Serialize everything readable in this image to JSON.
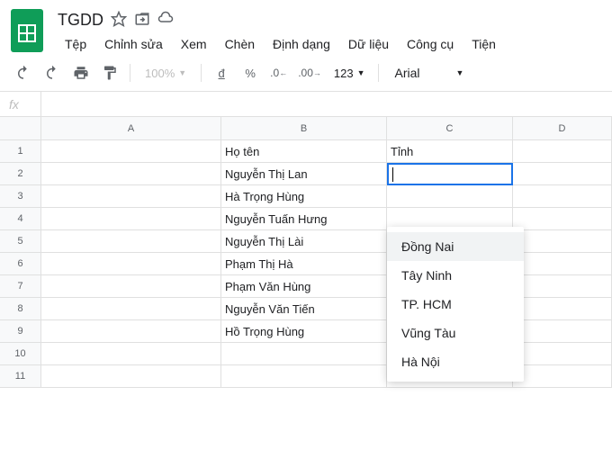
{
  "doc": {
    "title": "TGDD"
  },
  "menu": {
    "file": "Tệp",
    "edit": "Chỉnh sửa",
    "view": "Xem",
    "insert": "Chèn",
    "format": "Định dạng",
    "data": "Dữ liệu",
    "tools": "Công cụ",
    "extensions": "Tiện"
  },
  "toolbar": {
    "zoom": "100%",
    "currency": "đ",
    "percent": "%",
    "dec_dec": ".0",
    "inc_dec": ".00",
    "num_format": "123",
    "font": "Arial"
  },
  "formula": {
    "fx": "fx"
  },
  "columns": {
    "A": "A",
    "B": "B",
    "C": "C",
    "D": "D"
  },
  "rows": [
    "1",
    "2",
    "3",
    "4",
    "5",
    "6",
    "7",
    "8",
    "9",
    "10",
    "11"
  ],
  "cells": {
    "B1": "Họ tên",
    "C1": "Tỉnh",
    "B2": "Nguyễn Thị Lan",
    "B3": "Hà Trọng Hùng",
    "B4": "Nguyễn Tuấn Hưng",
    "B5": "Nguyễn Thị Lài",
    "B6": "Phạm Thị Hà",
    "B7": "Phạm Văn Hùng",
    "B8": "Nguyễn Văn Tiến",
    "B9": "Hồ Trọng Hùng"
  },
  "dropdown": {
    "items": [
      "Đồng Nai",
      "Tây Ninh",
      "TP. HCM",
      "Vũng Tàu",
      "Hà Nội"
    ]
  }
}
